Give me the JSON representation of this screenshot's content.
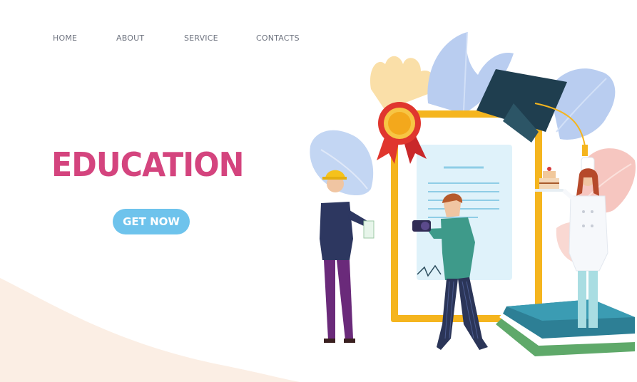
{
  "nav": {
    "items": [
      {
        "label": "HOME"
      },
      {
        "label": "ABOUT"
      },
      {
        "label": "SERVICE"
      },
      {
        "label": "CONTACTS"
      }
    ]
  },
  "hero": {
    "title": "EDUCATION",
    "cta_label": "GET NOW"
  },
  "colors": {
    "title": "#d4447e",
    "cta": "#6ec3ec",
    "nav_text": "#6f7480",
    "frame": "#f5b51e",
    "wave": "#fbeee4"
  },
  "illustration": {
    "icons": [
      "graduation-cap-icon",
      "certificate-seal-icon",
      "diploma-document",
      "camera-icon",
      "cake-icon",
      "books-stack"
    ]
  }
}
